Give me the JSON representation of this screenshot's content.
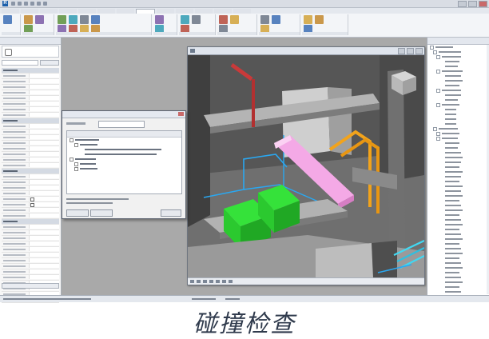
{
  "app": {
    "window_title": "",
    "logo_letter": "R"
  },
  "ribbon": {
    "tabs": [
      "",
      "",
      "",
      "",
      "",
      "",
      "",
      "",
      "",
      "",
      "",
      "",
      ""
    ],
    "active_tab_index": 7,
    "groups": [
      {
        "label": "",
        "buttons": [
          "select-icon"
        ]
      },
      {
        "label": "",
        "buttons": [
          "clipboard-icon",
          "cut-icon",
          "paste-icon"
        ]
      },
      {
        "label": "",
        "buttons": [
          "copy-icon",
          "rotate-icon",
          "mirror-icon",
          "align-icon",
          "trim-icon",
          "split-icon",
          "array-icon",
          "scale-icon"
        ]
      },
      {
        "label": "",
        "buttons": [
          "measure-icon",
          "dimension-icon"
        ]
      },
      {
        "label": "",
        "buttons": [
          "create-icon",
          "section-icon",
          "hide-icon"
        ]
      },
      {
        "label": "",
        "buttons": [
          "view-icon",
          "group-icon",
          "settings-icon"
        ]
      },
      {
        "label": "",
        "buttons": [
          "clash-icon",
          "report-icon",
          "link-icon"
        ]
      },
      {
        "label": "",
        "buttons": [
          "duct-icon",
          "pipe-icon",
          "connector-icon"
        ]
      }
    ]
  },
  "properties": {
    "title": "",
    "type_name": "",
    "filter_value": "",
    "edit_type_label": "",
    "apply_label": "",
    "rows": [
      {
        "section": true
      },
      {
        "section": false
      },
      {
        "section": false
      },
      {
        "section": false
      },
      {
        "section": false
      },
      {
        "section": false
      },
      {
        "section": false
      },
      {
        "section": false
      },
      {
        "section": false
      },
      {
        "section": true
      },
      {
        "section": false
      },
      {
        "section": false
      },
      {
        "section": false
      },
      {
        "section": false
      },
      {
        "section": false
      },
      {
        "section": false
      },
      {
        "section": false
      },
      {
        "section": false
      },
      {
        "section": true
      },
      {
        "section": false
      },
      {
        "section": false
      },
      {
        "section": false
      },
      {
        "section": false
      },
      {
        "section": false,
        "checkbox": true
      },
      {
        "section": false,
        "checkbox": true
      },
      {
        "section": false
      },
      {
        "section": false
      },
      {
        "section": true
      },
      {
        "section": false
      },
      {
        "section": false
      },
      {
        "section": false
      },
      {
        "section": false
      },
      {
        "section": false
      },
      {
        "section": false
      },
      {
        "section": false
      },
      {
        "section": false
      },
      {
        "section": false
      },
      {
        "section": false
      },
      {
        "section": false
      },
      {
        "section": false
      },
      {
        "section": false
      },
      {
        "section": false
      }
    ]
  },
  "view3d": {
    "title": "",
    "colors": {
      "magenta_duct": "#f4a9e6",
      "green_equipment": "#35e23a",
      "orange_pipe": "#f2a31b",
      "blue_pipe": "#2aa7f0",
      "red_pipe": "#c93a3a",
      "cyan_pipe": "#40d8f2",
      "concrete_light": "#c9c9c9",
      "concrete_dark": "#4c4c4c",
      "concrete_mid": "#8a8a8a"
    }
  },
  "clash_dialog": {
    "title": "",
    "grouping_label": "",
    "grouping_value": "",
    "tree_header": "",
    "tree_rows": [
      {
        "indent": 0,
        "expander": true,
        "width": 30
      },
      {
        "indent": 6,
        "expander": true,
        "width": 22
      },
      {
        "indent": 12,
        "expander": false,
        "width": 96
      },
      {
        "indent": 12,
        "expander": false,
        "width": 90
      },
      {
        "indent": 0,
        "expander": true,
        "width": 26
      },
      {
        "indent": 6,
        "expander": true,
        "width": 20
      },
      {
        "indent": 6,
        "expander": true,
        "width": 22
      }
    ],
    "info_lines": [
      "",
      ""
    ],
    "buttons": [
      "",
      "",
      ""
    ]
  },
  "project_browser": {
    "title": "",
    "rows": [
      {
        "indent": 0,
        "exp": true,
        "w": 22
      },
      {
        "indent": 4,
        "exp": true,
        "w": 28
      },
      {
        "indent": 8,
        "exp": true,
        "w": 24
      },
      {
        "indent": 12,
        "exp": false,
        "w": 18
      },
      {
        "indent": 12,
        "exp": false,
        "w": 16
      },
      {
        "indent": 8,
        "exp": true,
        "w": 26
      },
      {
        "indent": 12,
        "exp": false,
        "w": 20
      },
      {
        "indent": 12,
        "exp": false,
        "w": 22
      },
      {
        "indent": 12,
        "exp": false,
        "w": 18
      },
      {
        "indent": 8,
        "exp": true,
        "w": 24
      },
      {
        "indent": 12,
        "exp": false,
        "w": 20
      },
      {
        "indent": 12,
        "exp": false,
        "w": 16
      },
      {
        "indent": 8,
        "exp": true,
        "w": 22
      },
      {
        "indent": 12,
        "exp": false,
        "w": 14
      },
      {
        "indent": 12,
        "exp": false,
        "w": 14
      },
      {
        "indent": 12,
        "exp": false,
        "w": 14
      },
      {
        "indent": 12,
        "exp": false,
        "w": 14
      },
      {
        "indent": 4,
        "exp": true,
        "w": 24
      },
      {
        "indent": 8,
        "exp": true,
        "w": 22
      },
      {
        "indent": 8,
        "exp": true,
        "w": 20
      },
      {
        "indent": 12,
        "exp": false,
        "w": 18
      },
      {
        "indent": 12,
        "exp": false,
        "w": 16
      },
      {
        "indent": 12,
        "exp": false,
        "w": 20
      },
      {
        "indent": 12,
        "exp": false,
        "w": 22
      },
      {
        "indent": 12,
        "exp": false,
        "w": 20
      },
      {
        "indent": 12,
        "exp": false,
        "w": 18
      },
      {
        "indent": 12,
        "exp": false,
        "w": 22
      },
      {
        "indent": 12,
        "exp": false,
        "w": 20
      },
      {
        "indent": 12,
        "exp": false,
        "w": 18
      },
      {
        "indent": 12,
        "exp": false,
        "w": 22
      },
      {
        "indent": 12,
        "exp": false,
        "w": 20
      },
      {
        "indent": 12,
        "exp": false,
        "w": 22
      },
      {
        "indent": 12,
        "exp": false,
        "w": 18
      },
      {
        "indent": 12,
        "exp": false,
        "w": 20
      },
      {
        "indent": 12,
        "exp": false,
        "w": 22
      },
      {
        "indent": 12,
        "exp": false,
        "w": 18
      },
      {
        "indent": 12,
        "exp": false,
        "w": 20
      },
      {
        "indent": 12,
        "exp": false,
        "w": 22
      },
      {
        "indent": 12,
        "exp": false,
        "w": 18
      },
      {
        "indent": 12,
        "exp": false,
        "w": 20
      },
      {
        "indent": 12,
        "exp": false,
        "w": 22
      },
      {
        "indent": 12,
        "exp": false,
        "w": 18
      },
      {
        "indent": 12,
        "exp": false,
        "w": 20
      },
      {
        "indent": 12,
        "exp": false,
        "w": 22
      },
      {
        "indent": 12,
        "exp": false,
        "w": 18
      },
      {
        "indent": 12,
        "exp": false,
        "w": 20
      },
      {
        "indent": 12,
        "exp": false,
        "w": 22
      },
      {
        "indent": 12,
        "exp": false,
        "w": 18
      },
      {
        "indent": 12,
        "exp": false,
        "w": 20
      },
      {
        "indent": 12,
        "exp": false,
        "w": 22
      },
      {
        "indent": 12,
        "exp": false,
        "w": 18
      },
      {
        "indent": 12,
        "exp": false,
        "w": 20
      }
    ]
  },
  "status_bar": {
    "text": ""
  },
  "caption": "碰撞检查"
}
